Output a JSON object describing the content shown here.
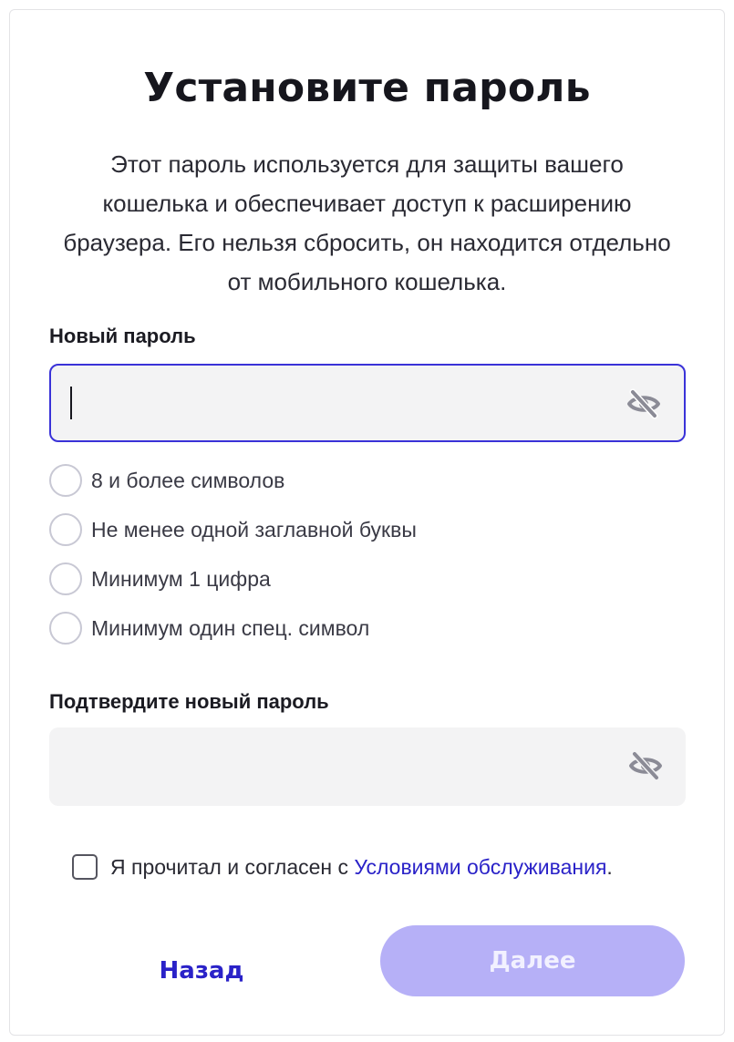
{
  "page": {
    "title": "Установите пароль",
    "description": "Этот пароль используется для защиты вашего кошелька и обеспечивает доступ к расширению браузера. Его нельзя сбросить, он находится отдельно от мобильного кошелька."
  },
  "new_password": {
    "label": "Новый пароль",
    "value": "",
    "visibility_icon": "eye-slash-icon"
  },
  "requirements": [
    {
      "label": "8 и более символов",
      "met": false
    },
    {
      "label": "Не менее одной заглавной буквы",
      "met": false
    },
    {
      "label": "Минимум 1 цифра",
      "met": false
    },
    {
      "label": "Минимум один спец. символ",
      "met": false
    }
  ],
  "confirm_password": {
    "label": "Подтвердите новый пароль",
    "value": "",
    "visibility_icon": "eye-slash-icon"
  },
  "terms": {
    "prefix": "Я прочитал и согласен с ",
    "link": "Условиями обслуживания",
    "suffix": ".",
    "checked": false
  },
  "buttons": {
    "back": "Назад",
    "next": "Далее",
    "next_disabled": true
  },
  "colors": {
    "accent": "#2a22c8",
    "focus_border": "#3a32d8",
    "disabled_button": "#b6b0f7",
    "field_bg": "#f3f3f4"
  }
}
